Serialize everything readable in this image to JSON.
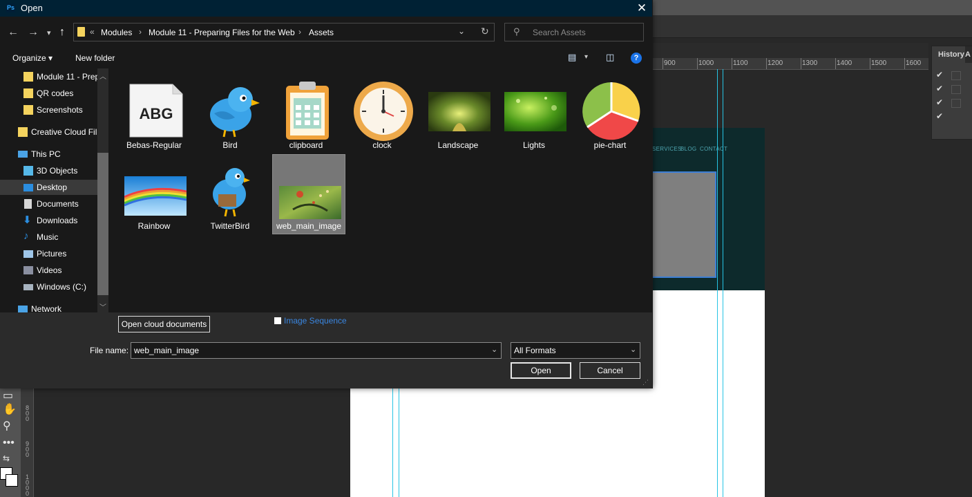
{
  "dialog": {
    "title": "Open",
    "app_icon_text": "Ps",
    "close_label": "✕"
  },
  "nav": {
    "back": "←",
    "forward": "→",
    "recent": "▾",
    "up": "↑"
  },
  "address": {
    "overflow": "«",
    "crumbs": [
      "Modules",
      "Module 11 - Preparing Files for the Web",
      "Assets"
    ],
    "separator": "›",
    "dropdown": "⌄",
    "refresh": "↻"
  },
  "search": {
    "icon": "search-icon",
    "placeholder": "Search Assets"
  },
  "toolbar": {
    "organize": "Organize",
    "organize_caret": "▾",
    "new_folder": "New folder",
    "help": "?"
  },
  "sidebar": {
    "items": [
      {
        "label": "Module 11 - Prep",
        "icon": "folder-icon"
      },
      {
        "label": "QR codes",
        "icon": "folder-icon"
      },
      {
        "label": "Screenshots",
        "icon": "folder-icon"
      },
      {
        "label": "Creative Cloud Fil",
        "icon": "creative-cloud-icon"
      },
      {
        "label": "This PC",
        "icon": "computer-icon"
      },
      {
        "label": "3D Objects",
        "icon": "cube-icon"
      },
      {
        "label": "Desktop",
        "icon": "desktop-icon",
        "selected": true
      },
      {
        "label": "Documents",
        "icon": "document-icon"
      },
      {
        "label": "Downloads",
        "icon": "download-icon"
      },
      {
        "label": "Music",
        "icon": "music-icon"
      },
      {
        "label": "Pictures",
        "icon": "pictures-icon"
      },
      {
        "label": "Videos",
        "icon": "video-icon"
      },
      {
        "label": "Windows (C:)",
        "icon": "drive-icon"
      },
      {
        "label": "Network",
        "icon": "network-icon"
      }
    ]
  },
  "files": [
    {
      "name": "Bebas-Regular",
      "thumb_text": "ABG",
      "icon": "font-file-icon"
    },
    {
      "name": "Bird",
      "icon": "bird-icon"
    },
    {
      "name": "clipboard",
      "icon": "clipboard-icon"
    },
    {
      "name": "clock",
      "icon": "clock-icon"
    },
    {
      "name": "Landscape",
      "icon": "landscape-image"
    },
    {
      "name": "Lights",
      "icon": "lights-image"
    },
    {
      "name": "pie-chart",
      "icon": "pie-chart-icon"
    },
    {
      "name": "Rainbow",
      "icon": "rainbow-image"
    },
    {
      "name": "TwitterBird",
      "icon": "twitter-bird-icon"
    },
    {
      "name": "web_main_image",
      "icon": "web-main-image",
      "selected": true
    }
  ],
  "bottom": {
    "open_cloud": "Open cloud documents",
    "image_sequence": "Image Sequence",
    "file_name_label": "File name:",
    "file_name_value": "web_main_image",
    "filter_value": "All Formats",
    "open_button": "Open",
    "cancel_button": "Cancel"
  },
  "photoshop": {
    "ruler_labels": [
      "900",
      "1000",
      "1100",
      "1200",
      "1300",
      "1400",
      "1500",
      "1600"
    ],
    "history_tab": "History",
    "history_tab2": "A",
    "canvas_nav": [
      "SERVICES",
      "BLOG",
      "CONTACT"
    ],
    "vruler_labels": [
      "800",
      "900",
      "1000"
    ]
  },
  "colors": {
    "titlebar": "#002134",
    "pane_bg": "#191919",
    "selection": "#777777",
    "guide": "#26c4e4",
    "link": "#3a86e0"
  }
}
